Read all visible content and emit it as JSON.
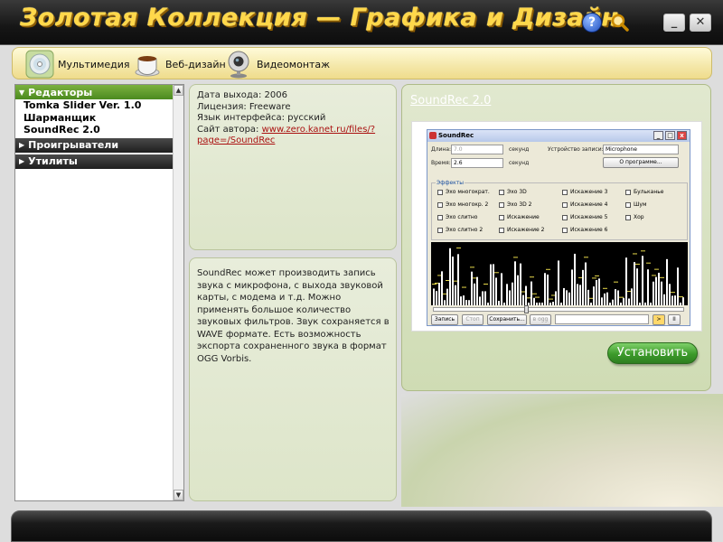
{
  "window": {
    "title": "Золотая Коллекция — Графика и Дизайн",
    "help_label": "?",
    "minimize_label": "_",
    "close_label": "✕"
  },
  "categories": [
    {
      "label": "Мультимедия",
      "icon": "disc-icon"
    },
    {
      "label": "Веб-дизайн",
      "icon": "coffee-cup-icon"
    },
    {
      "label": "Видеомонтаж",
      "icon": "webcam-icon"
    }
  ],
  "tree": {
    "editors_label": "Редакторы",
    "editors_items": [
      "Tomka Slider Ver. 1.0",
      "Шарманщик",
      "SoundRec 2.0"
    ],
    "players_label": "Проигрыватели",
    "utilities_label": "Утилиты"
  },
  "info": {
    "release": "Дата выхода: 2006",
    "license": "Лицензия: Freeware",
    "language": "Язык интерфейса: русский",
    "site_label": "Сайт автора: ",
    "site_url": "www.zero.kanet.ru/files/?page=/SoundRec"
  },
  "description": "SoundRec может производить запись звука с микрофона, с выхода звуковой карты, с модема и т.д. Можно применять большое количество звуковых фильтров. Звук сохраняется в WAVE формате. Есть возможность экспорта сохраненного звука в формат OGG Vorbis.",
  "program": {
    "title": "SoundRec 2.0",
    "install_label": "Установить"
  },
  "soundrec": {
    "title": "SoundRec",
    "length_label": "Длина:",
    "length_value": "7.0",
    "time_label": "Время:",
    "time_value": "2.6",
    "unit": "секунд",
    "device_label": "Устройство записи:",
    "device_value": "Microphone",
    "about_label": "О программе...",
    "effects_label": "Эффекты",
    "effects": [
      "Эхо многократ.",
      "Эхо 3D",
      "Искажение 3",
      "Бульканье",
      "Эхо многокр. 2",
      "Эхо 3D 2",
      "Искажение 4",
      "Шум",
      "Эхо слитно",
      "Искажение",
      "Искажение 5",
      "Хор",
      "Эхо слитно 2",
      "Искажение 2",
      "Искажение 6"
    ],
    "record_label": "Запись",
    "stop_label": "Стоп",
    "save_label": "Сохранить...",
    "ogg_label": "в ogg",
    "play_label": ">",
    "pause_label": "II"
  }
}
